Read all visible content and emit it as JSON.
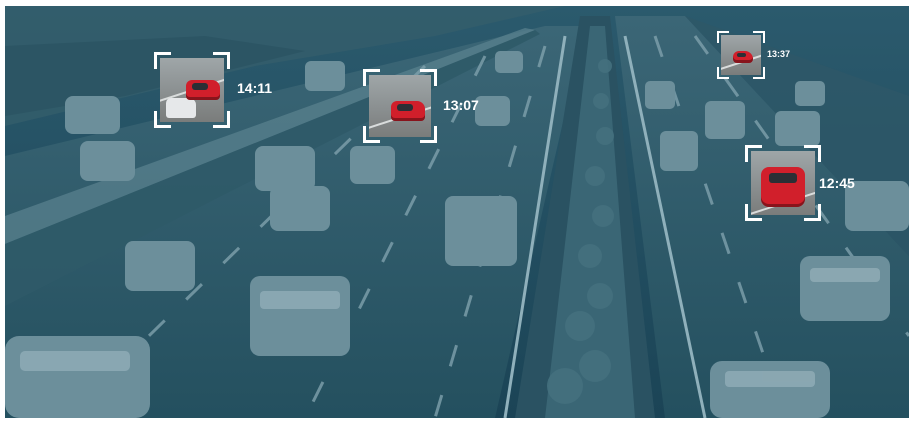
{
  "tracked_vehicles": [
    {
      "timestamp": "14:11"
    },
    {
      "timestamp": "13:07"
    },
    {
      "timestamp": "13:37"
    },
    {
      "timestamp": "12:45"
    }
  ],
  "colors": {
    "overlay_tint": "#1d4a5e",
    "frame_corners": "#ffffff",
    "highlighted_car": "#d11f2b",
    "timestamp_text": "#ffffff"
  }
}
